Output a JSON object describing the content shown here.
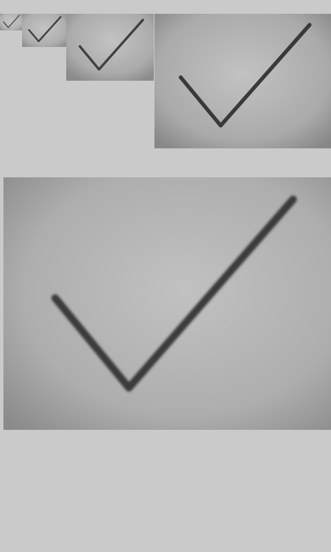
{
  "screen": {
    "background_color": "#cacaca"
  },
  "thumbnails": [
    {
      "label": "",
      "icon": "checkmark-icon"
    },
    {
      "label": "",
      "icon": "checkmark-icon"
    },
    {
      "label": "",
      "icon": "checkmark-icon"
    },
    {
      "label": "",
      "icon": "checkmark-icon"
    }
  ],
  "preview": {
    "label": "",
    "icon": "checkmark-icon"
  },
  "colors": {
    "photo_light": "#bdbdbd",
    "photo_mid": "#a9a9a9",
    "photo_dark": "#8a8a8a",
    "stroke": "#333333"
  }
}
